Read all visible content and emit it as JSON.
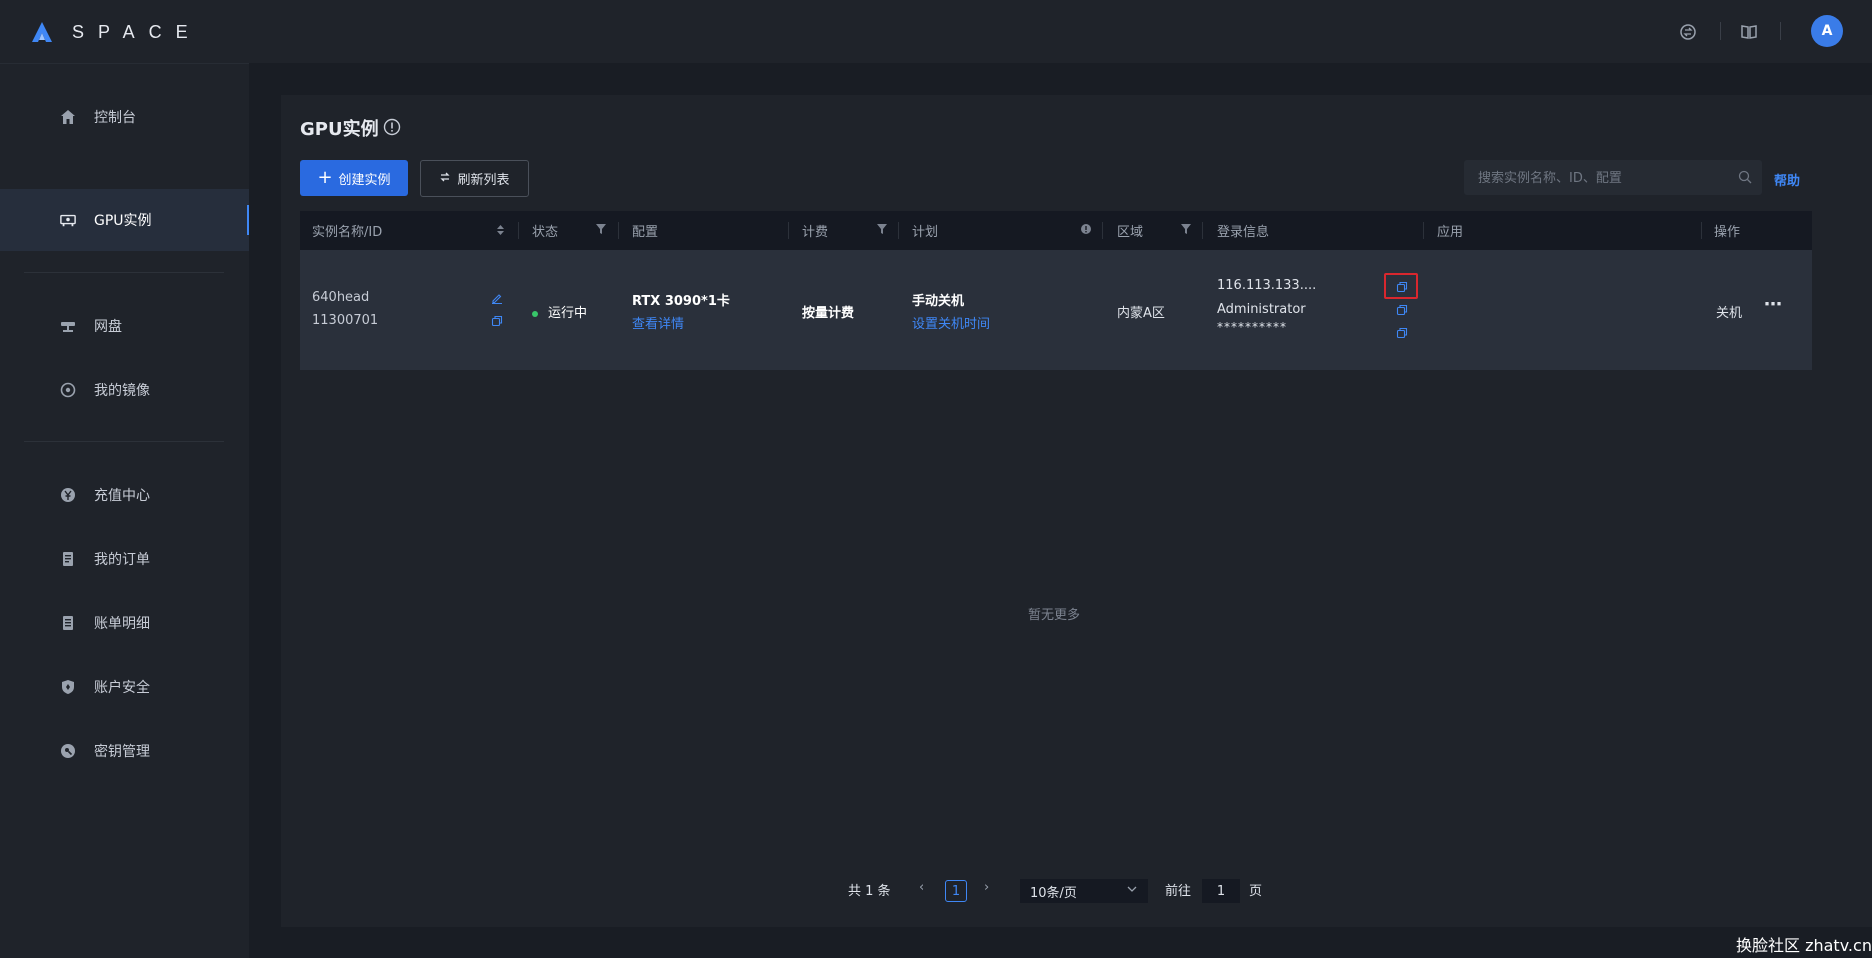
{
  "brand": {
    "name": "SPACE"
  },
  "sidebar": {
    "items": [
      {
        "label": "控制台",
        "icon": "home-icon"
      },
      {
        "label": "GPU实例",
        "icon": "gpu-icon",
        "active": true
      },
      {
        "label": "网盘",
        "icon": "network-disk-icon"
      },
      {
        "label": "我的镜像",
        "icon": "image-disc-icon"
      },
      {
        "label": "充值中心",
        "icon": "yuan-icon"
      },
      {
        "label": "我的订单",
        "icon": "order-icon"
      },
      {
        "label": "账单明细",
        "icon": "bill-icon"
      },
      {
        "label": "账户安全",
        "icon": "shield-icon"
      },
      {
        "label": "密钥管理",
        "icon": "key-icon"
      }
    ]
  },
  "header": {
    "avatar_letter": "A"
  },
  "page": {
    "title": "GPU实例",
    "create_button": "创建实例",
    "refresh_button": "刷新列表",
    "search_placeholder": "搜索实例名称、ID、配置",
    "help_link": "帮助"
  },
  "table": {
    "columns": [
      "实例名称/ID",
      "状态",
      "配置",
      "计费",
      "计划",
      "区域",
      "登录信息",
      "应用",
      "操作"
    ],
    "rows": [
      {
        "name": "640head",
        "id": "11300701",
        "status": "运行中",
        "config": "RTX 3090*1卡",
        "config_link": "查看详情",
        "billing": "按量计费",
        "plan": "手动关机",
        "plan_link": "设置关机时间",
        "region": "内蒙A区",
        "login_host": "116.113.133....",
        "login_user": "Administrator",
        "login_password": "**********",
        "action": "关机"
      }
    ],
    "empty_text": "暂无更多"
  },
  "pagination": {
    "total_text": "共 1 条",
    "current_page": "1",
    "page_size": "10条/页",
    "goto_label": "前往",
    "goto_value": "1",
    "page_suffix": "页"
  },
  "watermark": "换脸社区 zhatv.cn",
  "colors": {
    "accent": "#3f87f5",
    "primary_button": "#2a6ae0",
    "status_running": "#38c66a",
    "highlight_box": "#d9272e"
  }
}
